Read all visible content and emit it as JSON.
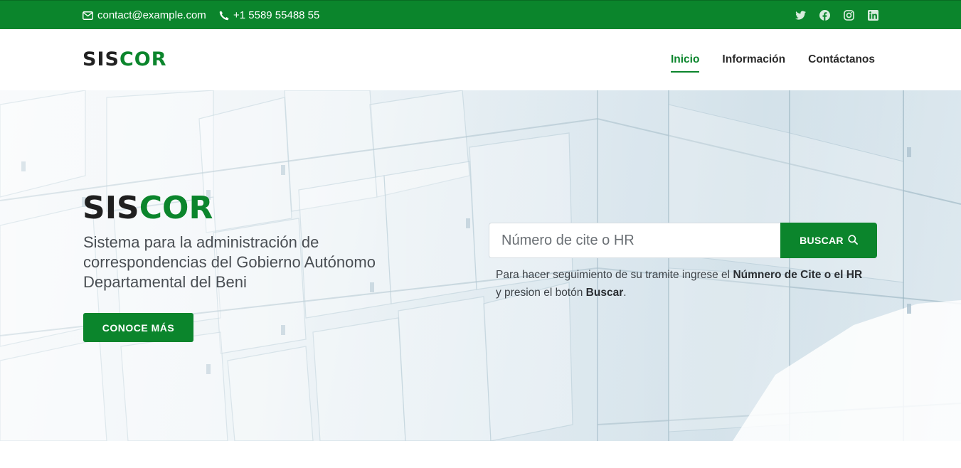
{
  "topbar": {
    "email": "contact@example.com",
    "phone": "+1 5589 55488 55",
    "social": [
      "twitter-icon",
      "facebook-icon",
      "instagram-icon",
      "linkedin-icon"
    ]
  },
  "header": {
    "logo_part1": "SIS",
    "logo_part2": "COR",
    "nav": [
      {
        "label": "Inicio",
        "active": true
      },
      {
        "label": "Información",
        "active": false
      },
      {
        "label": "Contáctanos",
        "active": false
      }
    ]
  },
  "hero": {
    "brand_part1": "SIS",
    "brand_part2": "COR",
    "subtitle": "Sistema para la administración de correspondencias del Gobierno Autónomo Departamental del Beni",
    "cta_label": "CONOCE MÁS"
  },
  "search": {
    "placeholder": "Número de cite o HR",
    "value": "",
    "button_label": "BUSCAR",
    "help_prefix": "Para hacer seguimiento de su tramite ingrese el ",
    "help_bold1": "Númnero de Cite o el HR",
    "help_middle": " y presion el botón ",
    "help_bold2": "Buscar",
    "help_suffix": "."
  },
  "colors": {
    "brand_green": "#0b852c",
    "dark_text": "#222222"
  }
}
